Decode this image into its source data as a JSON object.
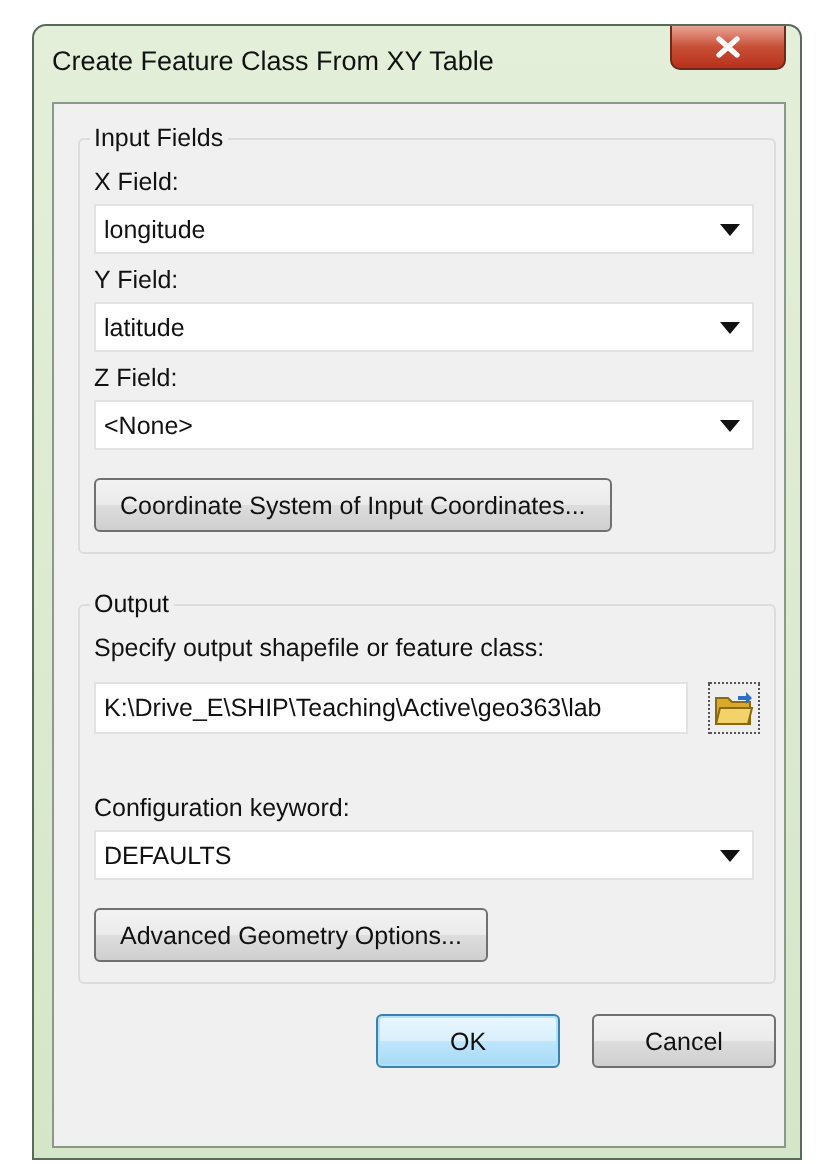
{
  "window": {
    "title": "Create Feature Class From XY Table"
  },
  "groups": [
    {
      "title": "Input Fields",
      "items": [
        {
          "kind": "label",
          "text": "X Field:"
        },
        {
          "kind": "combo",
          "value": "longitude"
        },
        {
          "kind": "label",
          "text": "Y Field:"
        },
        {
          "kind": "combo",
          "value": "latitude"
        },
        {
          "kind": "label",
          "text": "Z Field:"
        },
        {
          "kind": "combo",
          "value": "<None>"
        },
        {
          "kind": "button",
          "text": "Coordinate System of Input Coordinates..."
        }
      ]
    },
    {
      "title": "Output",
      "items": [
        {
          "kind": "label",
          "text": "Specify output shapefile or feature class:"
        },
        {
          "kind": "path",
          "value": "K:\\Drive_E\\SHIP\\Teaching\\Active\\geo363\\lab"
        },
        {
          "kind": "label",
          "text": "Configuration keyword:"
        },
        {
          "kind": "combo",
          "value": "DEFAULTS"
        },
        {
          "kind": "button",
          "text": "Advanced Geometry Options..."
        }
      ]
    }
  ],
  "buttons": [
    {
      "text": "OK",
      "default": true
    },
    {
      "text": "Cancel",
      "default": false
    }
  ]
}
